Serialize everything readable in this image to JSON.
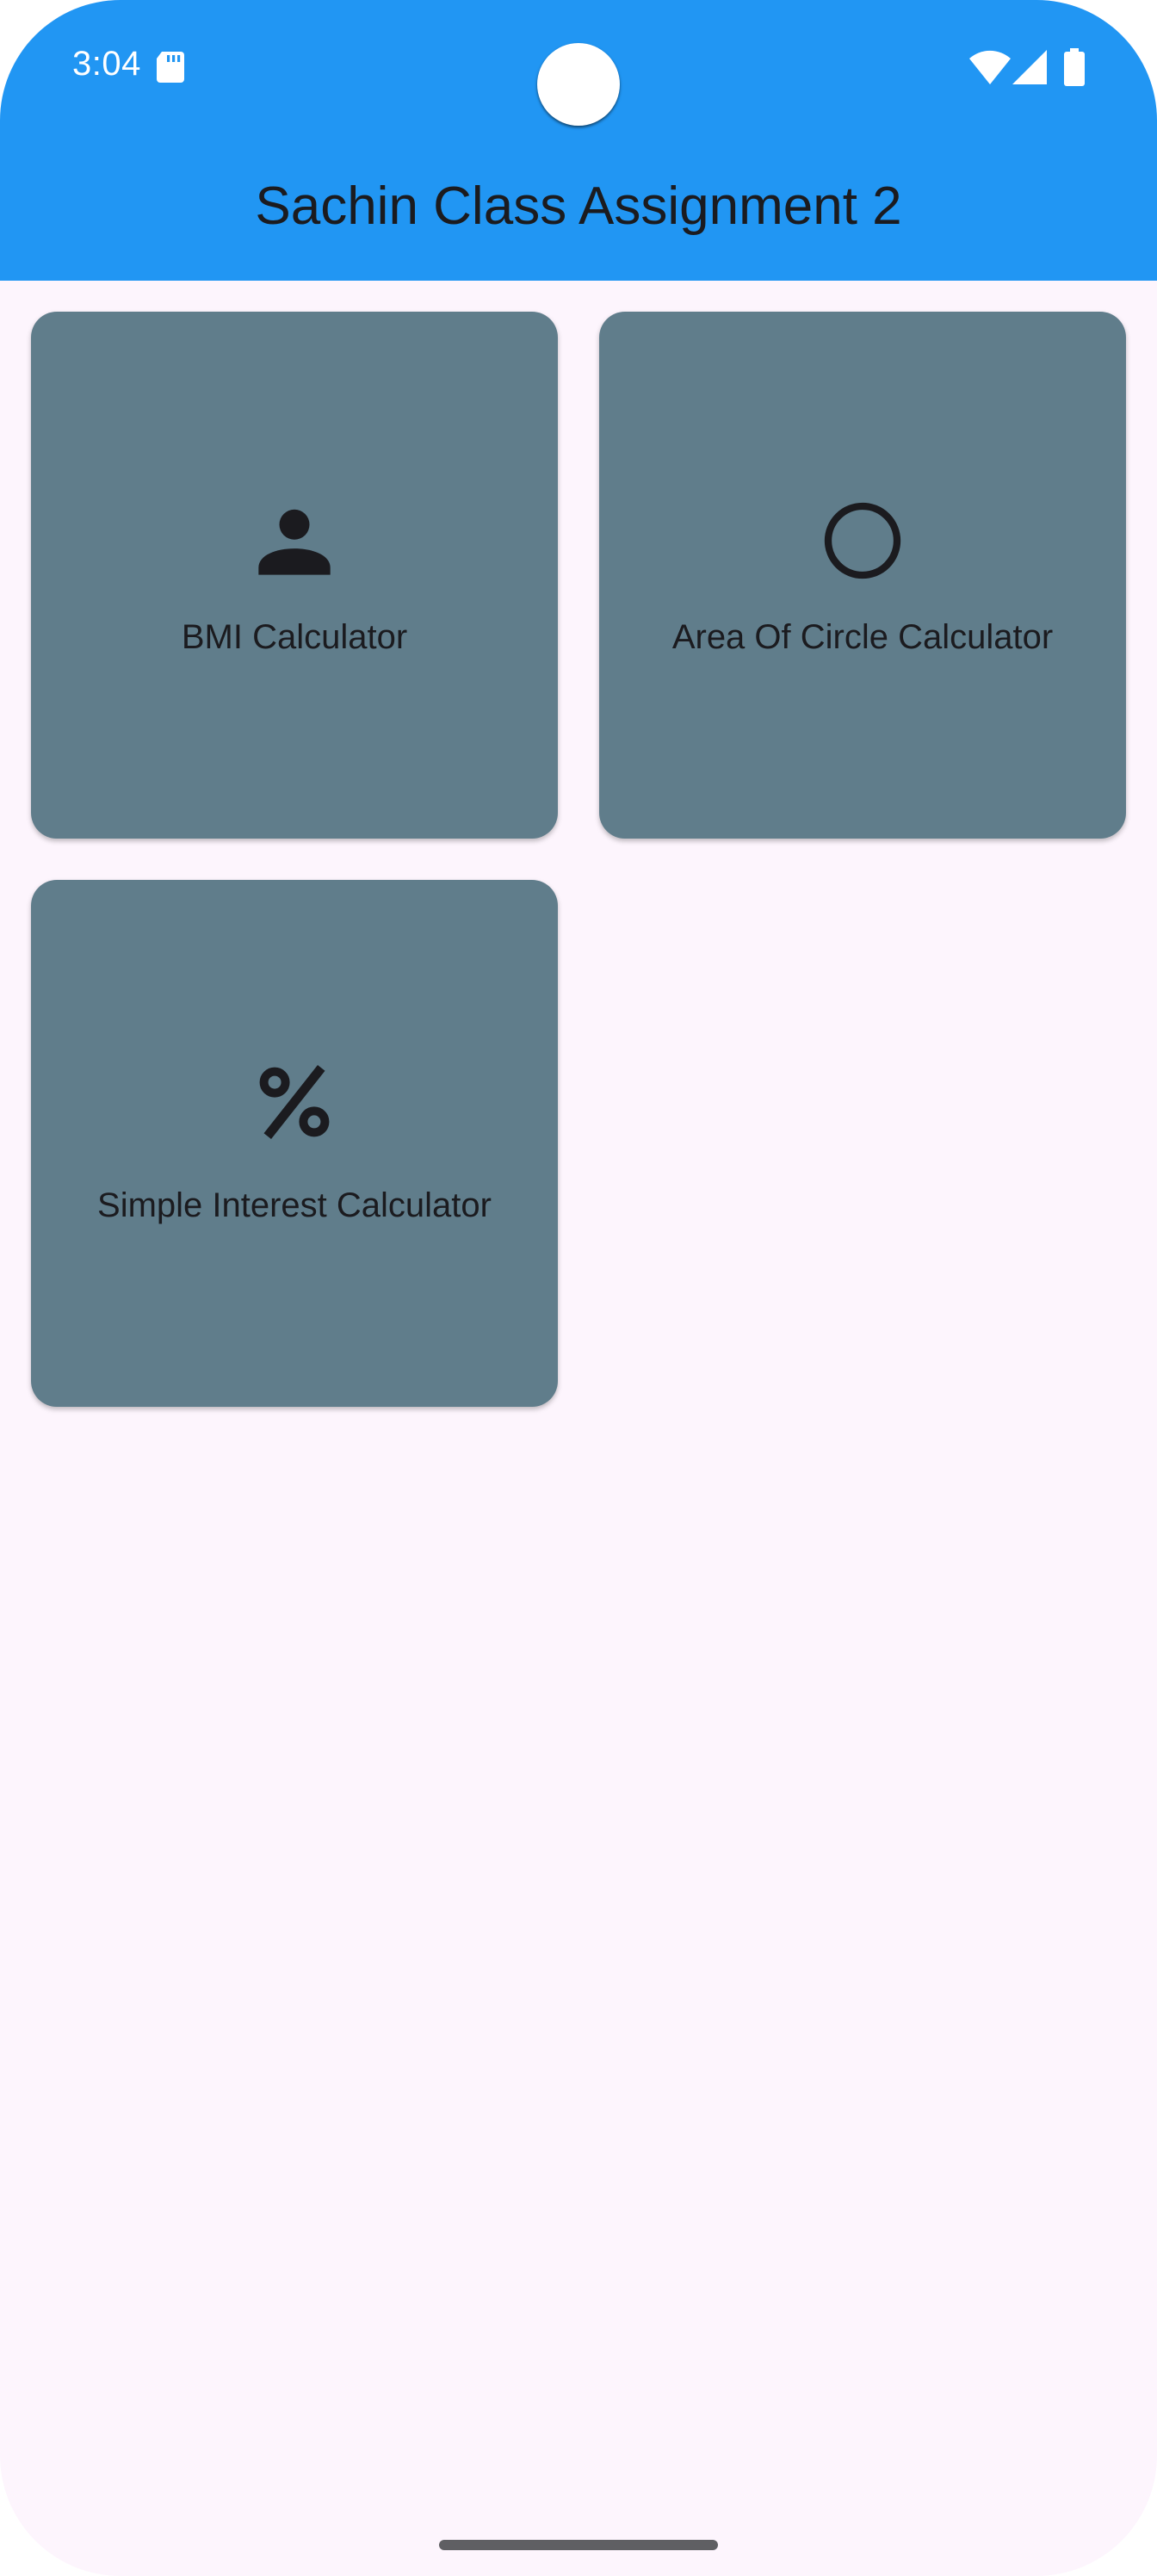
{
  "status_bar": {
    "time": "3:04",
    "icons": [
      "sd-card-icon",
      "wifi-icon",
      "cellular-signal-icon",
      "battery-icon"
    ]
  },
  "app_bar": {
    "title": "Sachin Class Assignment 2"
  },
  "cards": [
    {
      "label": "BMI Calculator",
      "icon": "person-icon"
    },
    {
      "label": "Area Of Circle Calculator",
      "icon": "circle-outline-icon"
    },
    {
      "label": "Simple Interest Calculator",
      "icon": "percent-icon"
    }
  ],
  "colors": {
    "app_bar": "#2196f3",
    "background": "#fdf5fd",
    "card": "#607d8b",
    "text": "#1b1b1f"
  }
}
